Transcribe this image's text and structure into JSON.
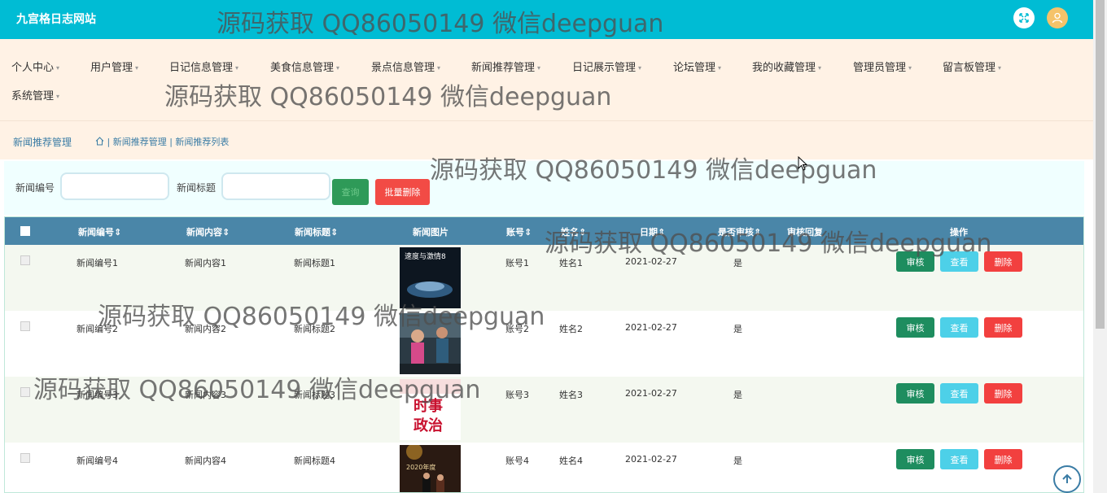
{
  "app": {
    "title": "九宫格日志网站"
  },
  "nav": {
    "items": [
      "个人中心",
      "用户管理",
      "日记信息管理",
      "美食信息管理",
      "景点信息管理",
      "新闻推荐管理",
      "日记展示管理",
      "论坛管理",
      "我的收藏管理",
      "管理员管理",
      "留言板管理",
      "系统管理"
    ]
  },
  "breadcrumb": {
    "title": "新闻推荐管理",
    "path": "| 新闻推荐管理 | 新闻推荐列表"
  },
  "search": {
    "label_id": "新闻编号",
    "label_title": "新闻标题",
    "id_value": "",
    "title_value": "",
    "search_label": "查询",
    "batch_delete_label": "批量删除"
  },
  "table": {
    "headers": [
      "新闻编号",
      "新闻内容",
      "新闻标题",
      "新闻图片",
      "账号",
      "姓名",
      "日期",
      "是否审核",
      "审核回复",
      "操作"
    ],
    "rows": [
      {
        "id": "新闻编号1",
        "content": "新闻内容1",
        "title": "新闻标题1",
        "account": "账号1",
        "name": "姓名1",
        "date": "2021-02-27",
        "audited": "是",
        "reply": ""
      },
      {
        "id": "新闻编号2",
        "content": "新闻内容2",
        "title": "新闻标题2",
        "account": "账号2",
        "name": "姓名2",
        "date": "2021-02-27",
        "audited": "是",
        "reply": ""
      },
      {
        "id": "新闻编号3",
        "content": "新闻内容3",
        "title": "新闻标题3",
        "account": "账号3",
        "name": "姓名3",
        "date": "2021-02-27",
        "audited": "是",
        "reply": ""
      },
      {
        "id": "新闻编号4",
        "content": "新闻内容4",
        "title": "新闻标题4",
        "account": "账号4",
        "name": "姓名4",
        "date": "2021-02-27",
        "audited": "是",
        "reply": ""
      }
    ],
    "actions": {
      "audit": "审核",
      "view": "查看",
      "delete": "删除"
    },
    "thumb_text": {
      "row1": "速度与激情8",
      "row3a": "时事",
      "row3b": "政治",
      "row4": "2020年度"
    }
  },
  "watermark": "源码获取 QQ86050149 微信deepguan",
  "colors": {
    "header": "#00bcd4",
    "nav_bg": "#fff2e5",
    "table_head": "#4a86a8",
    "audit": "#1e8d5f",
    "view": "#4dd0e8",
    "delete": "#f2403f"
  }
}
